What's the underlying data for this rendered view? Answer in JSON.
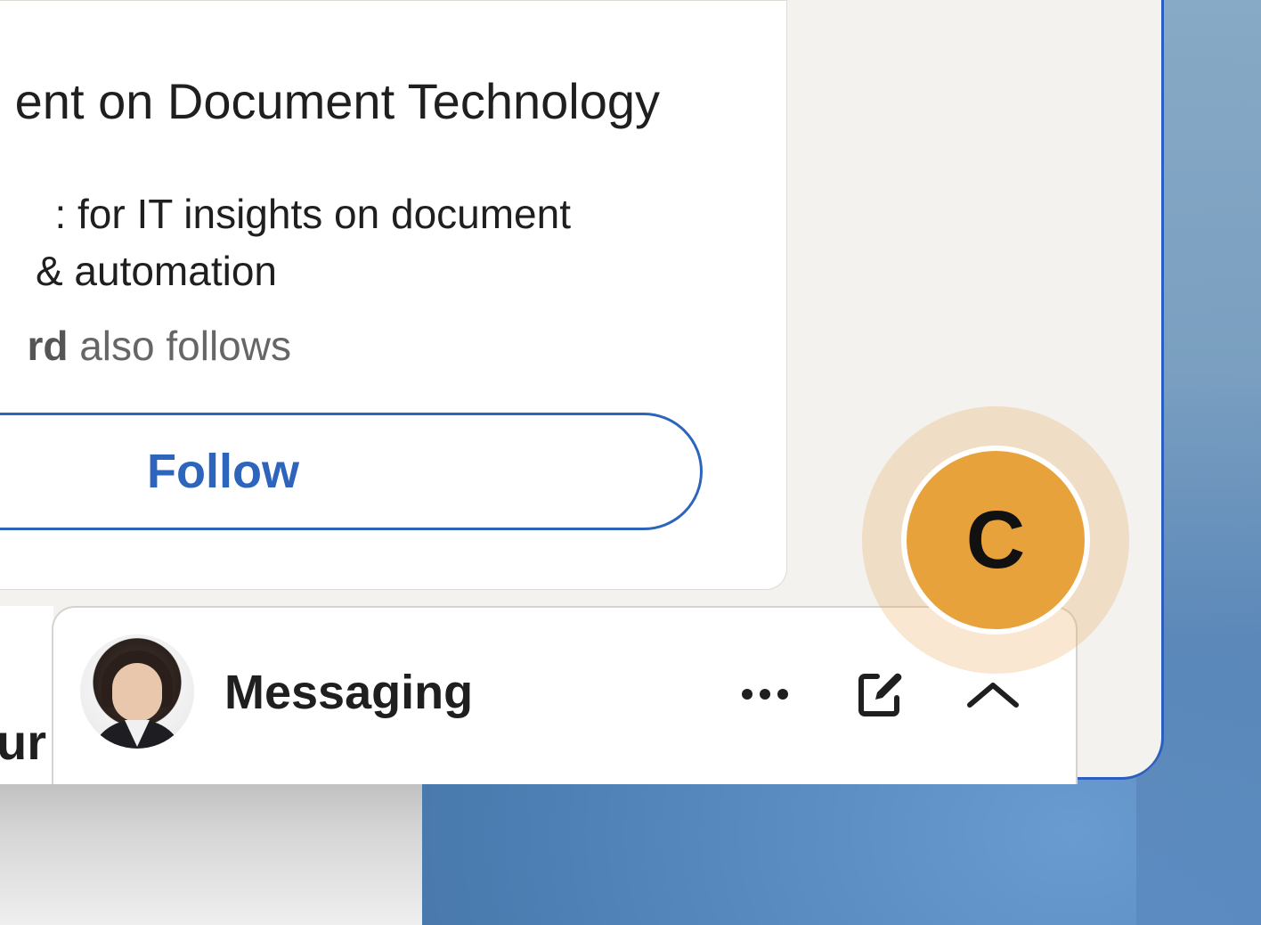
{
  "suggestion_card": {
    "title": "ent on Document Technology",
    "description_line1": ": for IT insights on document",
    "description_line2": " & automation",
    "follower_name_fragment": "rd",
    "also_follows": " also follows",
    "follow_label": "Follow"
  },
  "left_partial": {
    "text": "ur"
  },
  "messaging": {
    "title": "Messaging",
    "avatar_icon": "user-avatar-photo",
    "more_icon": "ellipsis-icon",
    "compose_icon": "compose-message-icon",
    "collapse_icon": "chevron-up-icon"
  },
  "badge": {
    "letter": "C"
  },
  "colors": {
    "accent_blue": "#2d64bc",
    "badge_orange": "#e8a23c",
    "page_background": "#f3f2ef"
  }
}
